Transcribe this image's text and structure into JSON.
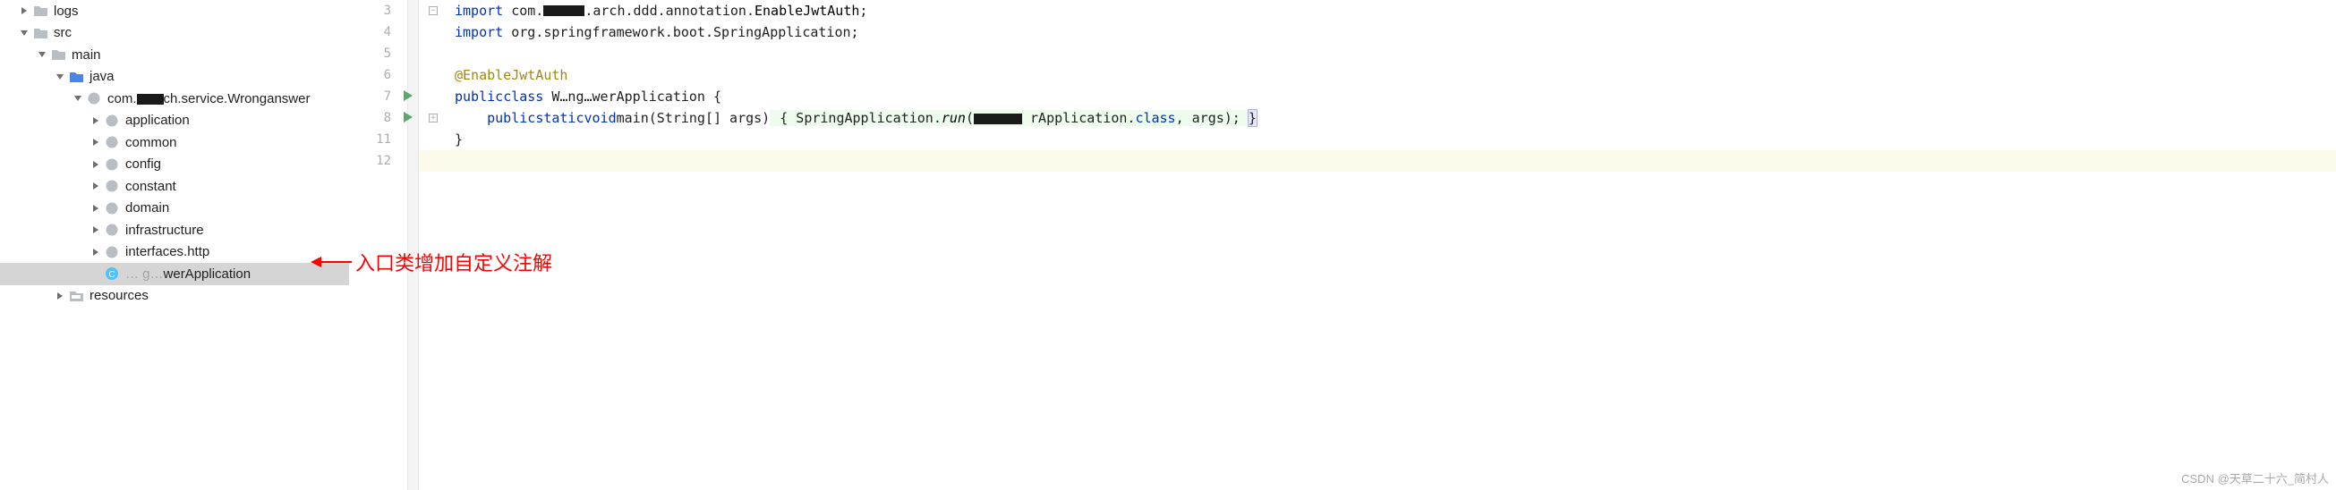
{
  "tree": {
    "items": [
      {
        "depth": 1,
        "arrow": "right",
        "icon": "folder-grey",
        "label": "logs"
      },
      {
        "depth": 1,
        "arrow": "down",
        "icon": "folder-grey",
        "label": "src"
      },
      {
        "depth": 2,
        "arrow": "down",
        "icon": "folder-grey",
        "label": "main"
      },
      {
        "depth": 3,
        "arrow": "down",
        "icon": "folder-blue",
        "label": "java"
      },
      {
        "depth": 4,
        "arrow": "down",
        "icon": "package",
        "label_prefix": "com.",
        "label_obscured": true,
        "label_suffix": "ch.service.Wronganswer"
      },
      {
        "depth": 5,
        "arrow": "right",
        "icon": "package",
        "label": "application"
      },
      {
        "depth": 5,
        "arrow": "right",
        "icon": "package",
        "label": "common"
      },
      {
        "depth": 5,
        "arrow": "right",
        "icon": "package",
        "label": "config"
      },
      {
        "depth": 5,
        "arrow": "right",
        "icon": "package",
        "label": "constant"
      },
      {
        "depth": 5,
        "arrow": "right",
        "icon": "package",
        "label": "domain"
      },
      {
        "depth": 5,
        "arrow": "right",
        "icon": "package",
        "label": "infrastructure"
      },
      {
        "depth": 5,
        "arrow": "right",
        "icon": "package",
        "label": "interfaces.http"
      },
      {
        "depth": 5,
        "arrow": "none",
        "icon": "class",
        "label_dim_prefix": "… g…",
        "label": "werApplication",
        "selected": true
      },
      {
        "depth": 3,
        "arrow": "right",
        "icon": "resources",
        "label": "resources"
      }
    ]
  },
  "gutter": {
    "lines": [
      3,
      4,
      5,
      6,
      7,
      8,
      11,
      12
    ],
    "run_markers": [
      7,
      8
    ],
    "fold_markers": {
      "3": "minus",
      "8": "plus"
    }
  },
  "code": {
    "l3": {
      "kw": "import",
      "pkg": " com.",
      "obsc": true,
      "pkg2": ".arch.ddd.annotation.",
      "cls": "EnableJwtAuth",
      "tail": ";"
    },
    "l4": {
      "kw": "import",
      "pkg": " org.springframework.boot.SpringApplication;"
    },
    "l6": {
      "ann": "@EnableJwtAuth"
    },
    "l7": {
      "kw1": "public",
      "kw2": "class",
      "gap": " W…ng…wer",
      "cls": "Application {"
    },
    "l8": {
      "indent": "    ",
      "kw1": "public",
      "kw2": "static",
      "kw3": "void",
      "m": "main",
      "args1": "(String[] args)",
      "brace": " { SpringApplication.",
      "run": "run",
      "open": "(",
      "obsc": true,
      "tail1": "rApplication.",
      "kw4": "class",
      "tail2": ", args); ",
      "close": "}"
    },
    "l11": {
      "text": "}"
    }
  },
  "annotation": {
    "text": "入口类增加自定义注解"
  },
  "watermark": "CSDN @天草二十六_简村人"
}
